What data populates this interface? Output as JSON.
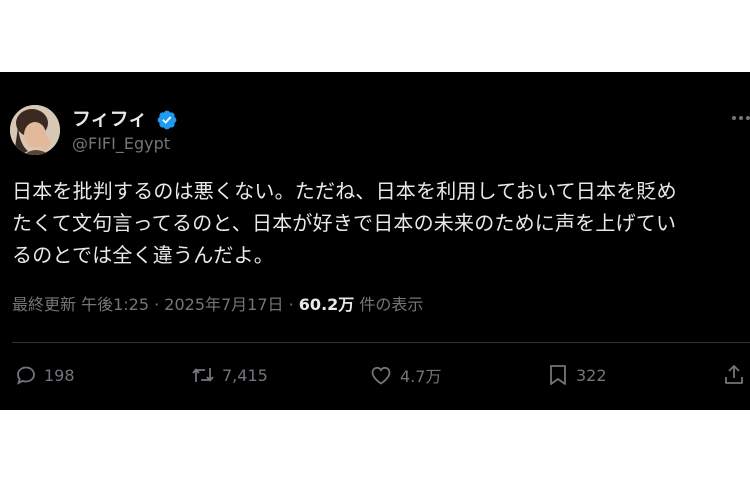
{
  "author": {
    "display_name": "フィフィ",
    "handle": "@FIFI_Egypt"
  },
  "tweet": {
    "text_line1": "日本を批判するのは悪くない。ただね、日本を利用しておいて日本を貶め",
    "text_line2": "たくて文句言ってるのと、日本が好きで日本の未来のために声を上げてい",
    "text_line3": "るのとでは全く違うんだよ。"
  },
  "meta": {
    "time_label": "最終更新 午後1:25 · 2025年7月17日 · ",
    "views_count": "60.2万",
    "views_label": " 件の表示"
  },
  "actions": {
    "replies": "198",
    "retweets": "7,415",
    "likes": "4.7万",
    "bookmarks": "322"
  },
  "icons": {
    "verified": "verified-badge-icon",
    "more": "more-options-icon",
    "reply": "reply-icon",
    "retweet": "retweet-icon",
    "like": "heart-icon",
    "bookmark": "bookmark-icon",
    "share": "share-icon"
  },
  "colors": {
    "background": "#000000",
    "text": "#e7e9ea",
    "muted": "#71767b",
    "verified": "#1d9bf0"
  }
}
